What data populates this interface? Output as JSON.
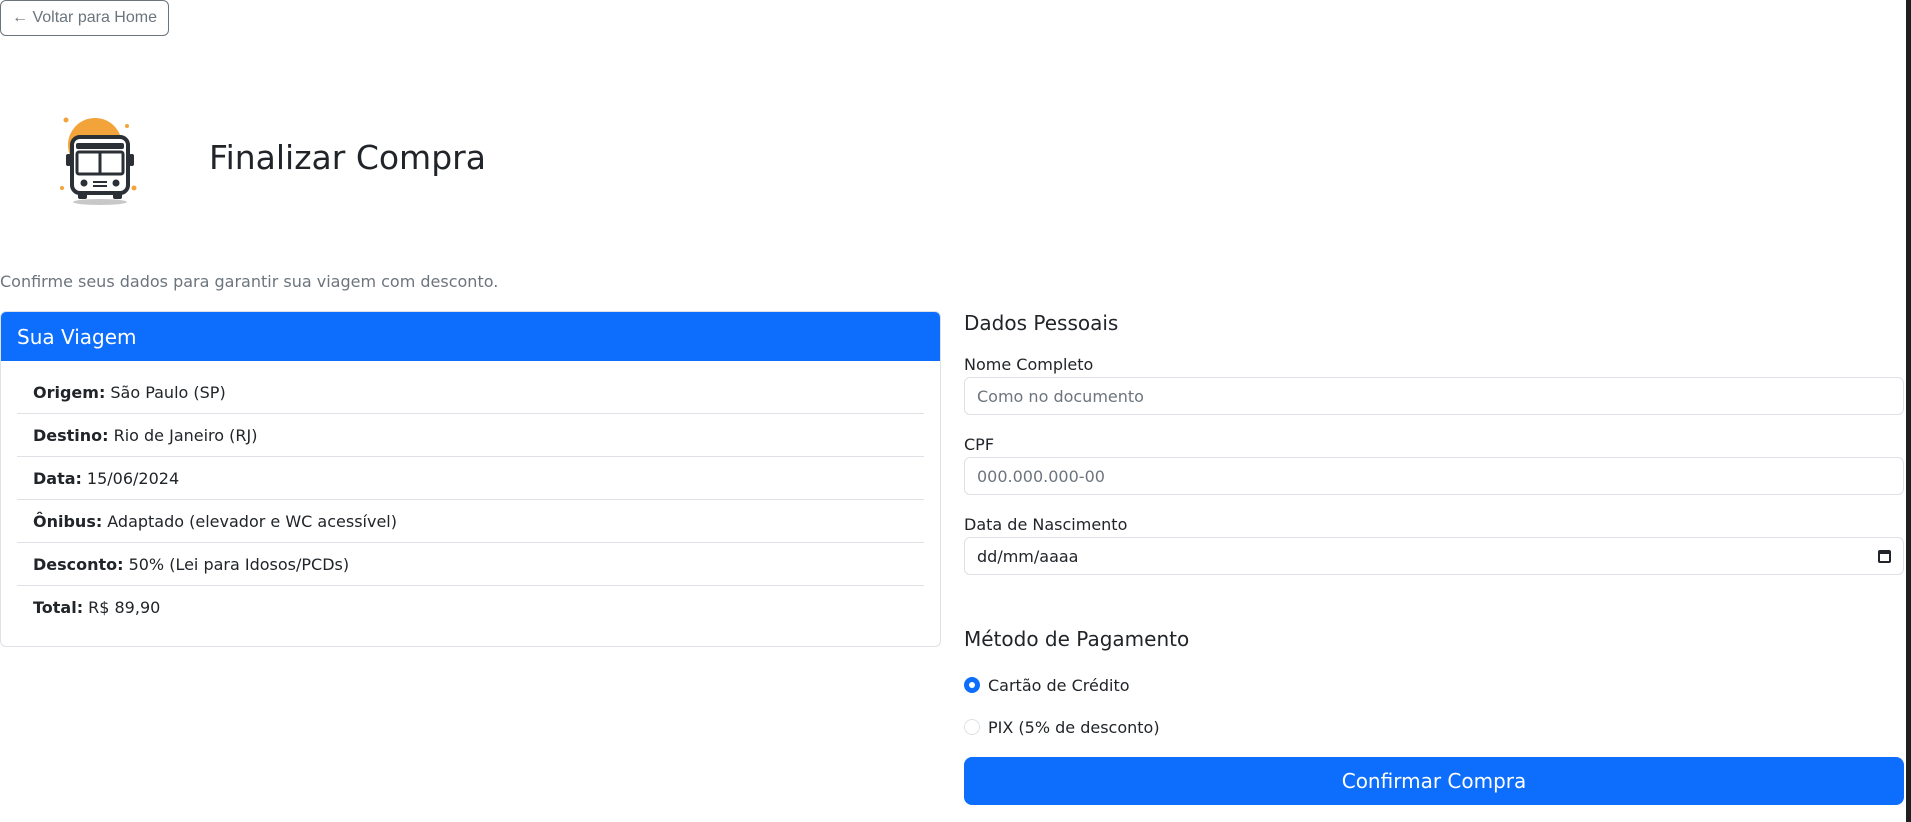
{
  "nav": {
    "back_label": "← Voltar para Home"
  },
  "header": {
    "title": "Finalizar Compra",
    "subtitle": "Confirme seus dados para garantir sua viagem com desconto."
  },
  "trip": {
    "header": "Sua Viagem",
    "items": [
      {
        "label": "Origem:",
        "value": "São Paulo (SP)"
      },
      {
        "label": "Destino:",
        "value": "Rio de Janeiro (RJ)"
      },
      {
        "label": "Data:",
        "value": "15/06/2024"
      },
      {
        "label": "Ônibus:",
        "value": "Adaptado (elevador e WC acessível)"
      },
      {
        "label": "Desconto:",
        "value": "50% (Lei para Idosos/PCDs)"
      },
      {
        "label": "Total:",
        "value": "R$ 89,90"
      }
    ]
  },
  "personal": {
    "title": "Dados Pessoais",
    "name_label": "Nome Completo",
    "name_placeholder": "Como no documento",
    "cpf_label": "CPF",
    "cpf_placeholder": "000.000.000-00",
    "birth_label": "Data de Nascimento",
    "birth_value": "dd/mm/aaaa"
  },
  "payment": {
    "title": "Método de Pagamento",
    "options": [
      {
        "label": "Cartão de Crédito",
        "checked": true
      },
      {
        "label": "PIX (5% de desconto)",
        "checked": false
      }
    ],
    "confirm_label": "Confirmar Compra"
  },
  "colors": {
    "primary": "#0d6efd",
    "muted": "#6c757d",
    "logo_sun": "#f2a33a",
    "logo_bus": "#2b2f36"
  },
  "icons": {
    "logo": "bus-logo-icon",
    "calendar": "calendar-icon"
  }
}
